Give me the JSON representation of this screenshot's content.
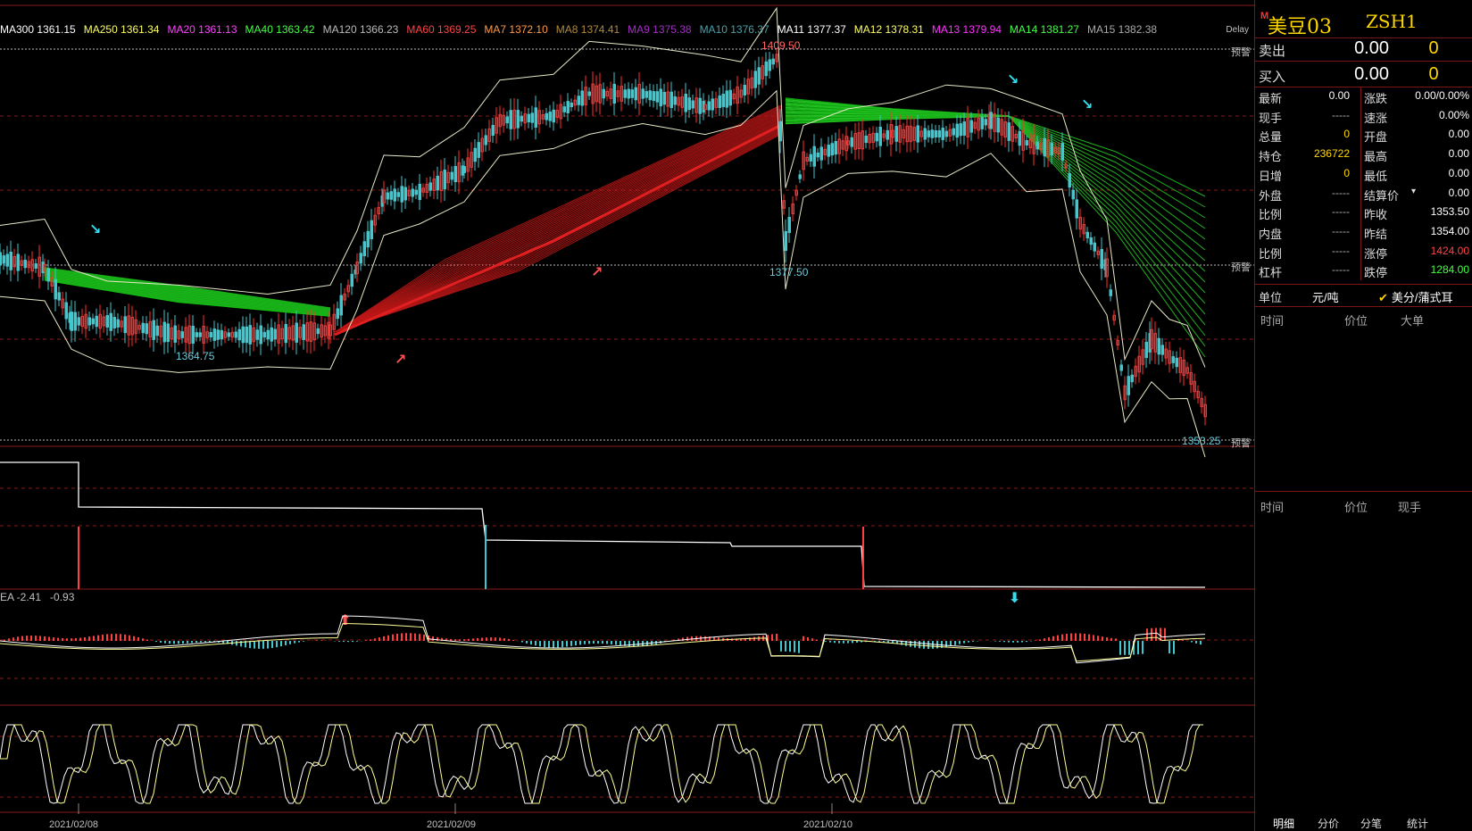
{
  "ma_bar": [
    {
      "label": "MA300 1361.15",
      "color": "#ffffff"
    },
    {
      "label": "MA250 1361.34",
      "color": "#ffff66"
    },
    {
      "label": "MA20 1361.13",
      "color": "#ff44ff"
    },
    {
      "label": "MA40 1363.42",
      "color": "#44ff44"
    },
    {
      "label": "MA120 1366.23",
      "color": "#bbbbbb"
    },
    {
      "label": "MA60 1369.25",
      "color": "#ff4444"
    },
    {
      "label": "MA7 1372.10",
      "color": "#ff9944"
    },
    {
      "label": "MA8 1374.41",
      "color": "#b08a3c"
    },
    {
      "label": "MA9 1375.38",
      "color": "#a030c0"
    },
    {
      "label": "MA10 1376.37",
      "color": "#4aa0a8"
    },
    {
      "label": "MA11 1377.37",
      "color": "#ffffff"
    },
    {
      "label": "MA12 1378.31",
      "color": "#ffff66"
    },
    {
      "label": "MA13 1379.94",
      "color": "#ff33ff"
    },
    {
      "label": "MA14 1381.27",
      "color": "#44ff44"
    },
    {
      "label": "MA15 1382.38",
      "color": "#aaaaaa"
    }
  ],
  "chart": {
    "delay_label": "Delay",
    "warning_label": "预警",
    "price_labels": {
      "high": "1409.50",
      "low1": "1364.75",
      "low2": "1377.50",
      "last": "1353.25"
    },
    "macd_label_a": "EA -2.41",
    "macd_label_b": "-0.93",
    "dates": [
      "2021/02/08",
      "2021/02/09",
      "2021/02/10"
    ]
  },
  "side": {
    "m_badge": "M",
    "instrument_name": "美豆03",
    "instrument_code": "ZSH1",
    "sell": {
      "label": "卖出",
      "price": "0.00",
      "volume": "0"
    },
    "buy": {
      "label": "买入",
      "price": "0.00",
      "volume": "0"
    },
    "quote_rows": [
      {
        "k1": "最新",
        "v1": "0.00",
        "c1": "#ffffff",
        "k2": "涨跌",
        "v2": "0.00/0.00%",
        "c2": "#ffffff"
      },
      {
        "k1": "现手",
        "v1": "-----",
        "c1": "#aaaaaa",
        "k2": "速涨",
        "v2": "0.00%",
        "c2": "#ffffff"
      },
      {
        "k1": "总量",
        "v1": "0",
        "c1": "#ffd700",
        "k2": "开盘",
        "v2": "0.00",
        "c2": "#ffffff"
      },
      {
        "k1": "持仓",
        "v1": "236722",
        "c1": "#ffd700",
        "k2": "最高",
        "v2": "0.00",
        "c2": "#ffffff"
      },
      {
        "k1": "日增",
        "v1": "0",
        "c1": "#ffd700",
        "k2": "最低",
        "v2": "0.00",
        "c2": "#ffffff"
      },
      {
        "k1": "外盘",
        "v1": "-----",
        "c1": "#aaaaaa",
        "k2": "结算价",
        "v2": "0.00",
        "c2": "#ffffff"
      },
      {
        "k1": "比例",
        "v1": "-----",
        "c1": "#aaaaaa",
        "k2": "昨收",
        "v2": "1353.50",
        "c2": "#ffffff"
      },
      {
        "k1": "内盘",
        "v1": "-----",
        "c1": "#aaaaaa",
        "k2": "昨结",
        "v2": "1354.00",
        "c2": "#ffffff"
      },
      {
        "k1": "比例",
        "v1": "-----",
        "c1": "#aaaaaa",
        "k2": "涨停",
        "v2": "1424.00",
        "c2": "#ff4444"
      },
      {
        "k1": "杠杆",
        "v1": "-----",
        "c1": "#aaaaaa",
        "k2": "跌停",
        "v2": "1284.00",
        "c2": "#44ff44"
      }
    ],
    "unit_label": "单位",
    "unit_value": "元/吨",
    "currency_check": "✔",
    "currency_label": "美分/蒲式耳",
    "table1_headers": [
      "时间",
      "价位",
      "大单"
    ],
    "table2_headers": [
      "时间",
      "价位",
      "现手"
    ],
    "tabs": [
      "明细",
      "分价",
      "分笔",
      "统计"
    ]
  }
}
